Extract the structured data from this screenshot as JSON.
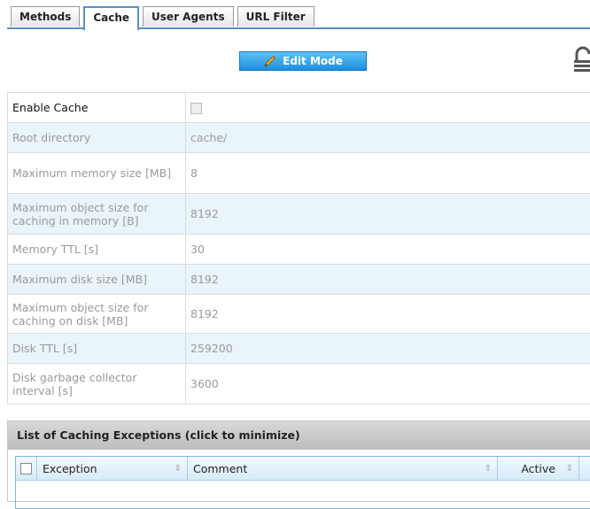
{
  "tabs": [
    "Methods",
    "Cache",
    "User Agents",
    "URL Filter"
  ],
  "active_tab": "Cache",
  "toolbar": {
    "edit_label": "Edit Mode"
  },
  "settings": {
    "enable_cache": {
      "label": "Enable Cache",
      "checked": false
    },
    "rows": [
      {
        "label": "Root directory",
        "value": "cache/"
      },
      {
        "label": "Maximum memory size [MB]",
        "value": "8"
      },
      {
        "label": "Maximum object size for caching in memory [B]",
        "value": "8192"
      },
      {
        "label": "Memory TTL [s]",
        "value": "30"
      },
      {
        "label": "Maximum disk size [MB]",
        "value": "8192"
      },
      {
        "label": "Maximum object size for caching on disk [MB]",
        "value": "8192"
      },
      {
        "label": "Disk TTL [s]",
        "value": "259200"
      },
      {
        "label": "Disk garbage collector interval [s]",
        "value": "3600"
      }
    ]
  },
  "exceptions": {
    "title": "List of Caching Exceptions (click to minimize)",
    "columns": [
      "Exception",
      "Comment",
      "Active"
    ]
  },
  "colors": {
    "accent": "#2196e8",
    "tab_border": "#5a8fc4",
    "row_alt": "#e9f4fb"
  },
  "icons": {
    "edit": "pencil-icon",
    "lock": "lock-icon",
    "sort": "sort-icon"
  }
}
